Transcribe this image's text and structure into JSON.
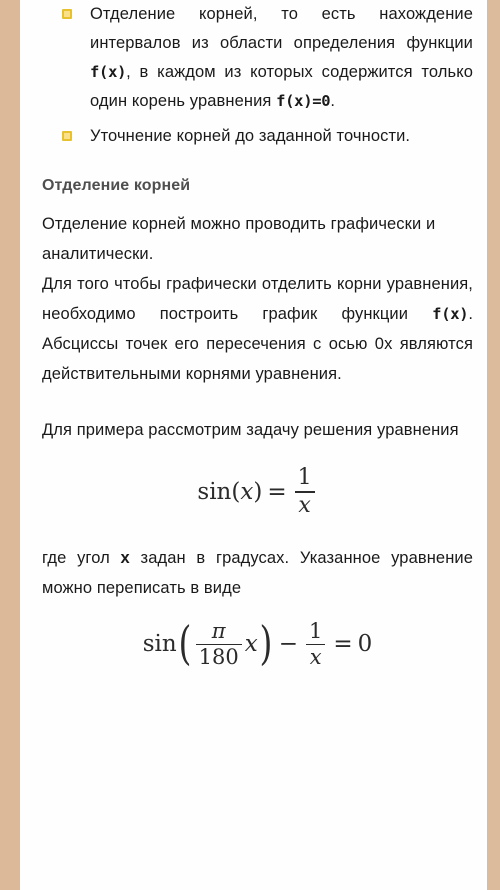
{
  "document": {
    "page_background": "#fefefe",
    "edge_color": "#dbb999",
    "bullet_color": "#e8c12f",
    "heading_color": "#4f4f4f",
    "body_color": "#1a1a1a"
  },
  "bullets": [
    {
      "text_part_1": "Отделение корней, то есть нахождение интервалов из области определения функции ",
      "mono_1": "f(x)",
      "text_part_2": ", в каждом из которых содержится только один корень уравнения ",
      "mono_2": "f(x)=0",
      "text_part_3": "."
    },
    {
      "text": "Уточнение корней до заданной точности."
    }
  ],
  "heading": "Отделение корней",
  "paragraphs": {
    "p1": "Отделение корней можно проводить графически и аналитически.",
    "p2_part_1": "Для того чтобы графически отделить корни уравнения, необходимо построить график функции ",
    "p2_mono": "f(x)",
    "p2_part_2": ". Абсциссы точек его пересечения с осью 0х являются действительными корнями уравнения.",
    "p3": "Для примера рассмотрим задачу решения уравнения",
    "p4_part_1": "где угол ",
    "p4_bold": "х",
    "p4_part_2": " задан в градусах. Указанное уравнение можно переписать в виде"
  },
  "formulas": {
    "formula_1": {
      "latex": "\\sin(x) = \\frac{1}{x}",
      "sin_label": "sin",
      "open_paren": "(",
      "arg": "x",
      "close_paren": ")",
      "equals": "=",
      "numerator": "1",
      "denominator": "x"
    },
    "formula_2": {
      "latex": "\\sin\\left(\\frac{\\pi}{180}x\\right) - \\frac{1}{x} = 0",
      "sin_label": "sin",
      "open_paren": "(",
      "pi": "π",
      "denominator_180": "180",
      "var_x": "x",
      "close_paren": ")",
      "minus": "−",
      "numerator_1": "1",
      "denominator_x": "x",
      "equals": "=",
      "result": "0"
    }
  }
}
